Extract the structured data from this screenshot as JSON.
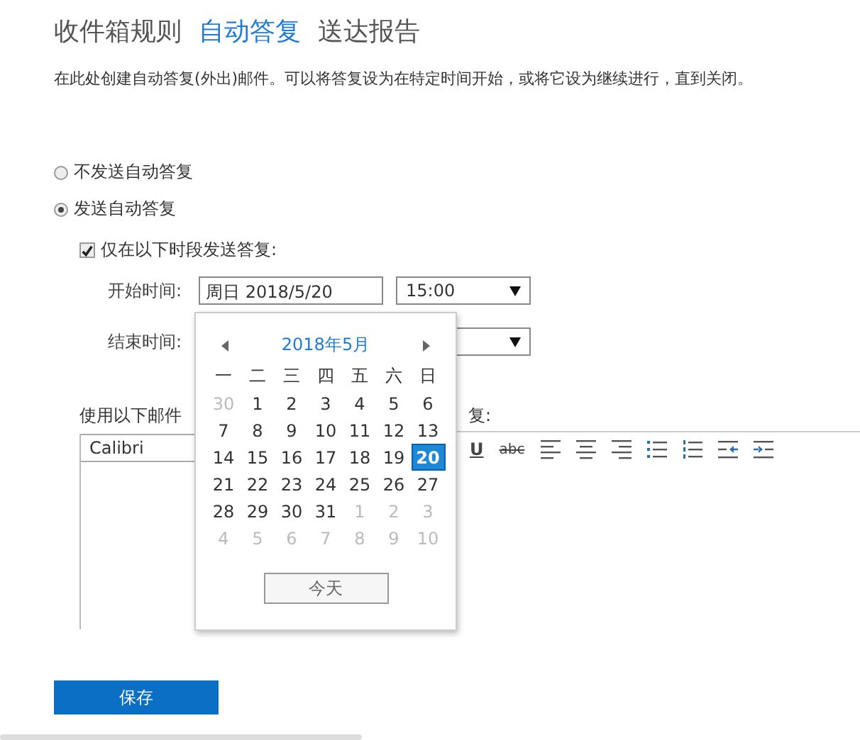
{
  "tabs": [
    {
      "label": "收件箱规则",
      "selected": false
    },
    {
      "label": "自动答复",
      "selected": true
    },
    {
      "label": "送达报告",
      "selected": false
    }
  ],
  "description": "在此处创建自动答复(外出)邮件。可以将答复设为在特定时间开始，或将它设为继续进行，直到关闭。",
  "reply_options": [
    {
      "label": "不发送自动答复",
      "selected": false
    },
    {
      "label": "发送自动答复",
      "selected": true
    }
  ],
  "time_limit": {
    "label": "仅在以下时段发送答复:",
    "checked": true
  },
  "start_time": {
    "label": "开始时间:",
    "date": "周日 2018/5/20",
    "time": "15:00"
  },
  "end_time": {
    "label": "结束时间:"
  },
  "editor": {
    "label_start": "使用以下邮件",
    "label_end": "复:",
    "font": "Calibri",
    "toolbar": [
      {
        "kind": "underline",
        "label": "U"
      },
      {
        "kind": "strike",
        "label": "abc"
      },
      {
        "kind": "align-left"
      },
      {
        "kind": "align-center"
      },
      {
        "kind": "align-right"
      },
      {
        "kind": "bullets"
      },
      {
        "kind": "numbering"
      },
      {
        "kind": "outdent"
      },
      {
        "kind": "indent"
      }
    ]
  },
  "calendar": {
    "month": "2018年5月",
    "weekdays": [
      "一",
      "二",
      "三",
      "四",
      "五",
      "六",
      "日"
    ],
    "days": [
      {
        "label": "30",
        "muted": true,
        "selected": false
      },
      {
        "label": "1",
        "muted": false,
        "selected": false
      },
      {
        "label": "2",
        "muted": false,
        "selected": false
      },
      {
        "label": "3",
        "muted": false,
        "selected": false
      },
      {
        "label": "4",
        "muted": false,
        "selected": false
      },
      {
        "label": "5",
        "muted": false,
        "selected": false
      },
      {
        "label": "6",
        "muted": false,
        "selected": false
      },
      {
        "label": "7",
        "muted": false,
        "selected": false
      },
      {
        "label": "8",
        "muted": false,
        "selected": false
      },
      {
        "label": "9",
        "muted": false,
        "selected": false
      },
      {
        "label": "10",
        "muted": false,
        "selected": false
      },
      {
        "label": "11",
        "muted": false,
        "selected": false
      },
      {
        "label": "12",
        "muted": false,
        "selected": false
      },
      {
        "label": "13",
        "muted": false,
        "selected": false
      },
      {
        "label": "14",
        "muted": false,
        "selected": false
      },
      {
        "label": "15",
        "muted": false,
        "selected": false
      },
      {
        "label": "16",
        "muted": false,
        "selected": false
      },
      {
        "label": "17",
        "muted": false,
        "selected": false
      },
      {
        "label": "18",
        "muted": false,
        "selected": false
      },
      {
        "label": "19",
        "muted": false,
        "selected": false
      },
      {
        "label": "20",
        "muted": false,
        "selected": true
      },
      {
        "label": "21",
        "muted": false,
        "selected": false
      },
      {
        "label": "22",
        "muted": false,
        "selected": false
      },
      {
        "label": "23",
        "muted": false,
        "selected": false
      },
      {
        "label": "24",
        "muted": false,
        "selected": false
      },
      {
        "label": "25",
        "muted": false,
        "selected": false
      },
      {
        "label": "26",
        "muted": false,
        "selected": false
      },
      {
        "label": "27",
        "muted": false,
        "selected": false
      },
      {
        "label": "28",
        "muted": false,
        "selected": false
      },
      {
        "label": "29",
        "muted": false,
        "selected": false
      },
      {
        "label": "30",
        "muted": false,
        "selected": false
      },
      {
        "label": "31",
        "muted": false,
        "selected": false
      },
      {
        "label": "1",
        "muted": true,
        "selected": false
      },
      {
        "label": "2",
        "muted": true,
        "selected": false
      },
      {
        "label": "3",
        "muted": true,
        "selected": false
      },
      {
        "label": "4",
        "muted": true,
        "selected": false
      },
      {
        "label": "5",
        "muted": true,
        "selected": false
      },
      {
        "label": "6",
        "muted": true,
        "selected": false
      },
      {
        "label": "7",
        "muted": true,
        "selected": false
      },
      {
        "label": "8",
        "muted": true,
        "selected": false
      },
      {
        "label": "9",
        "muted": true,
        "selected": false
      },
      {
        "label": "10",
        "muted": true,
        "selected": false
      }
    ],
    "today_button": "今天"
  },
  "save_button": "保存"
}
